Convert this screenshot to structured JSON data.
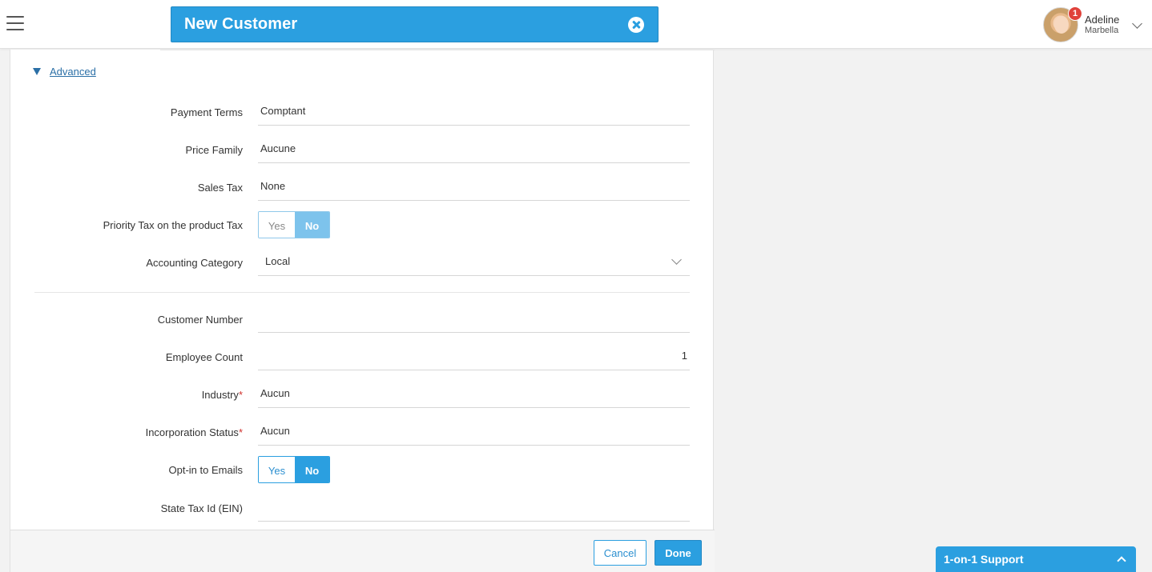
{
  "header": {
    "title": "New Customer",
    "notification_count": "1",
    "user_first_name": "Adeline",
    "user_last_name": "Marbella"
  },
  "advanced": {
    "link_label": "Advanced"
  },
  "form": {
    "payment_terms": {
      "label": "Payment Terms",
      "value": "Comptant"
    },
    "price_family": {
      "label": "Price Family",
      "value": "Aucune"
    },
    "sales_tax": {
      "label": "Sales Tax",
      "value": "None"
    },
    "priority_tax": {
      "label": "Priority Tax on the product Tax",
      "yes": "Yes",
      "no": "No",
      "selected": "No"
    },
    "accounting_category": {
      "label": "Accounting Category",
      "value": "Local"
    },
    "customer_number": {
      "label": "Customer Number",
      "value": ""
    },
    "employee_count": {
      "label": "Employee Count",
      "value": "1"
    },
    "industry": {
      "label": "Industry",
      "required_mark": "*",
      "value": "Aucun"
    },
    "incorporation_status": {
      "label": "Incorporation Status",
      "required_mark": "*",
      "value": "Aucun"
    },
    "opt_in_emails": {
      "label": "Opt-in to Emails",
      "yes": "Yes",
      "no": "No",
      "selected": "No"
    },
    "state_tax_id": {
      "label": "State Tax Id (EIN)",
      "value": ""
    }
  },
  "footer": {
    "cancel_label": "Cancel",
    "done_label": "Done"
  },
  "support": {
    "label": "1-on-1 Support"
  },
  "colors": {
    "accent": "#2b9fe0",
    "required": "#d0312d",
    "badge": "#e0423b"
  },
  "icons": [
    "menu-icon",
    "close-circle-icon",
    "chevron-down-icon",
    "triangle-down-icon",
    "chevron-up-icon"
  ]
}
